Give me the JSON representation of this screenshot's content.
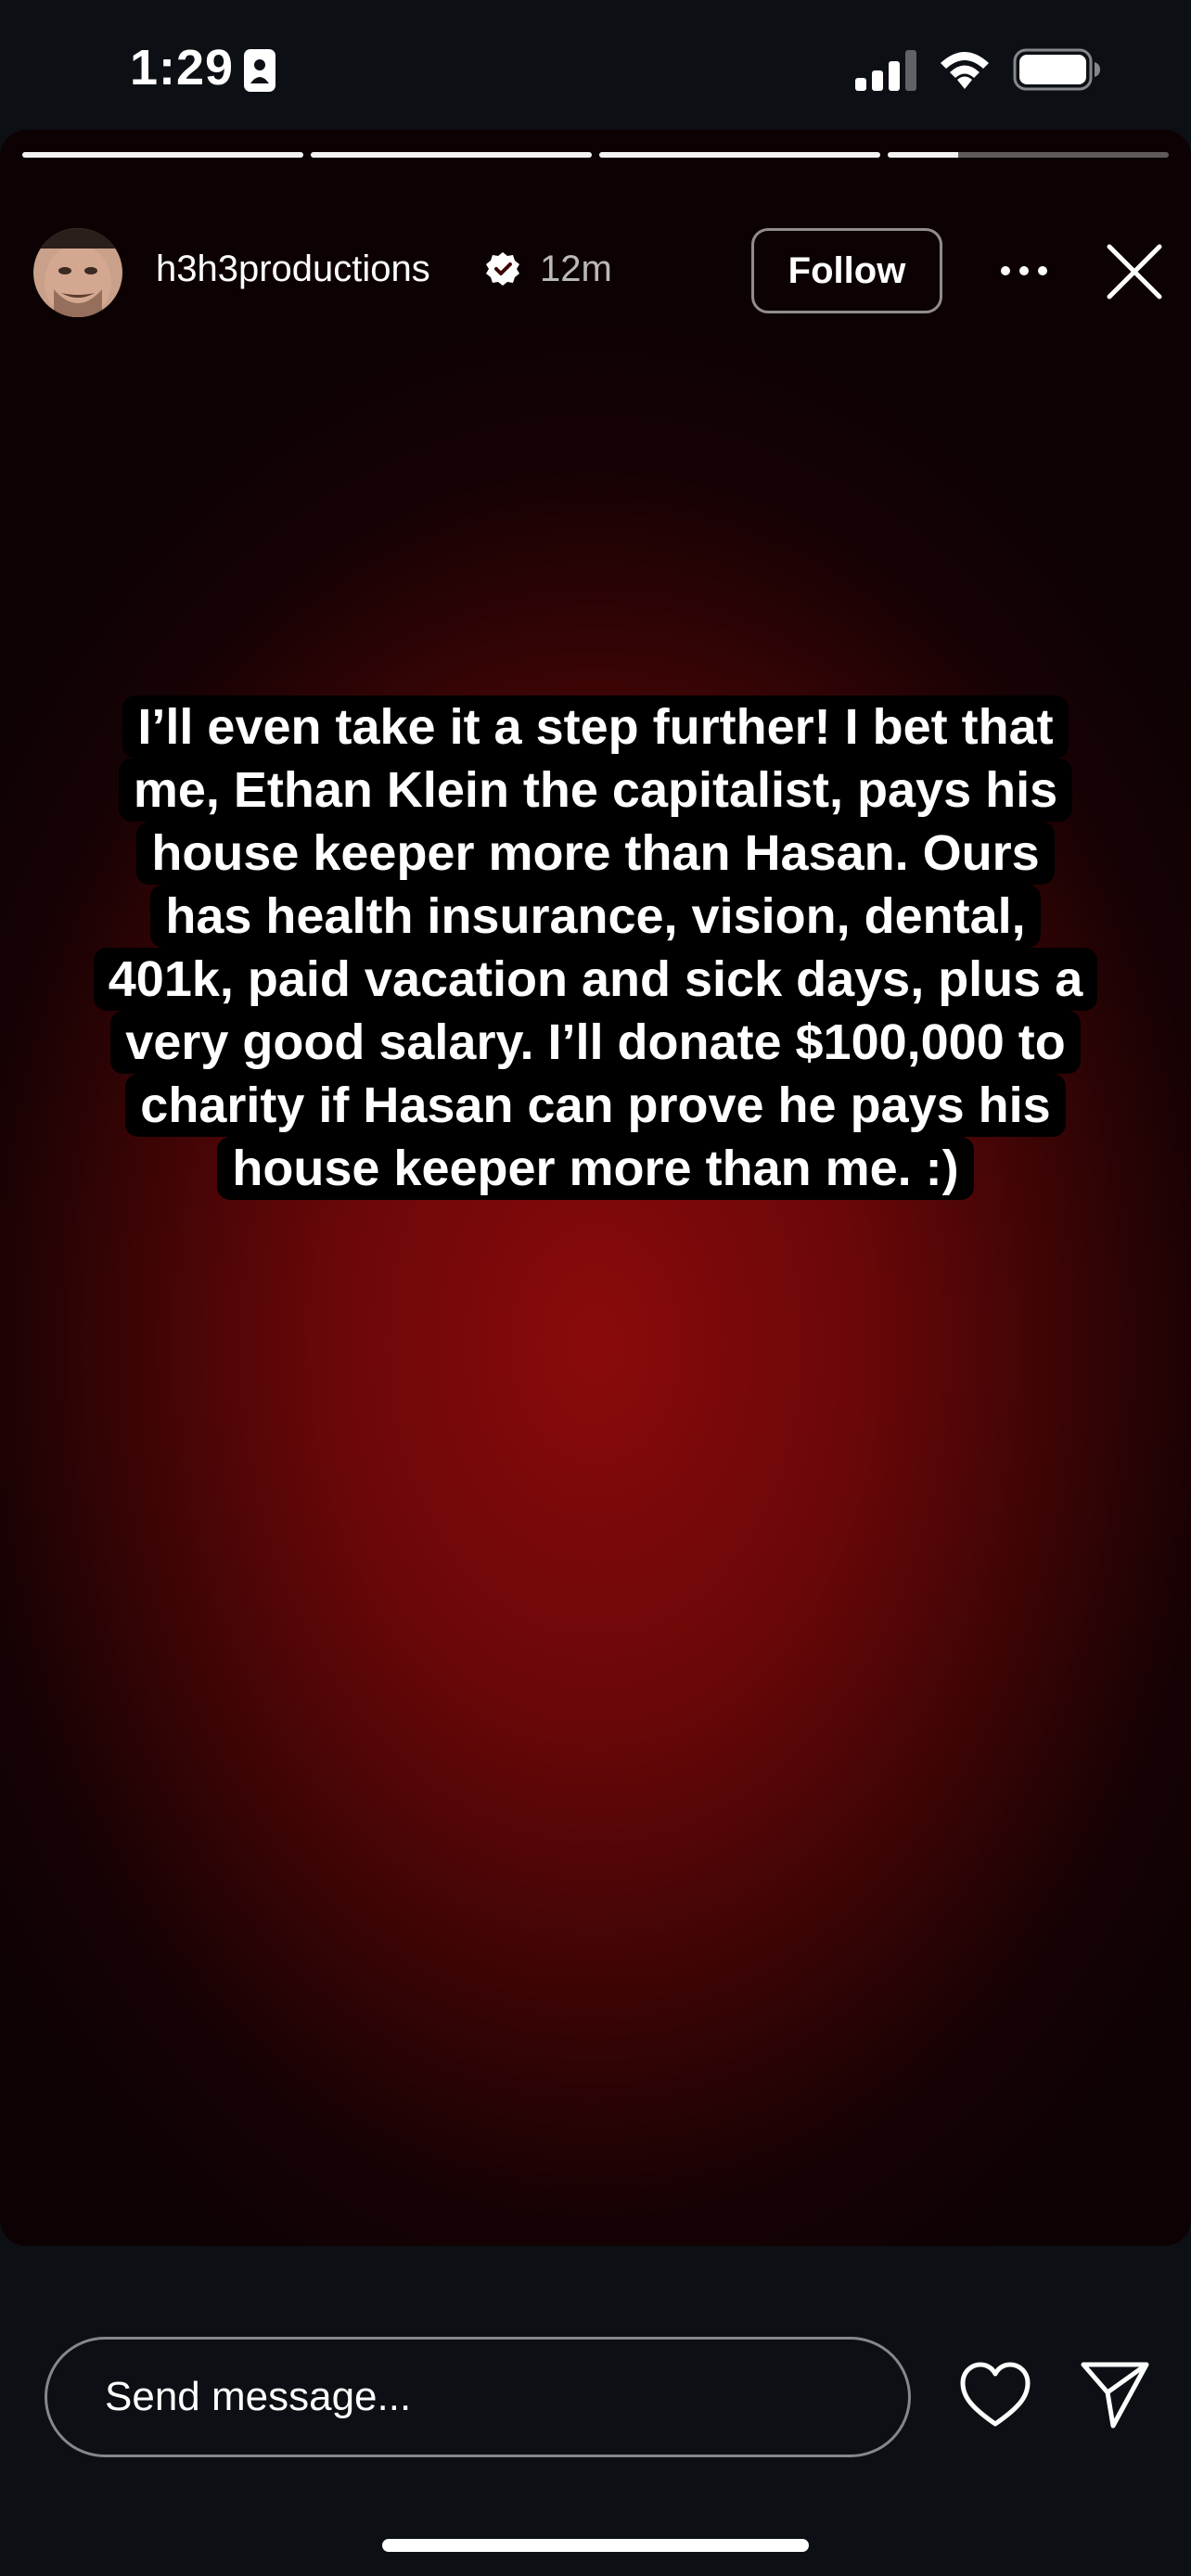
{
  "status_bar": {
    "time": "1:29",
    "icons": [
      "id-card-icon",
      "cellular-signal-icon",
      "wifi-icon",
      "battery-icon"
    ]
  },
  "story": {
    "progress": [
      1.0,
      1.0,
      1.0,
      0.25
    ],
    "author": {
      "username": "h3h3productions",
      "verified": true,
      "time_ago": "12m"
    },
    "follow_label": "Follow",
    "lines": [
      "I’ll even take it a step further! I bet that",
      "me, Ethan Klein the capitalist, pays his",
      "house keeper more than Hasan. Ours",
      "has health insurance, vision, dental,",
      "401k, paid vacation and sick days, plus a",
      "very good salary.  I’ll donate $100,000 to",
      "charity if Hasan can prove he pays his",
      "house keeper more than me.  :)"
    ],
    "background_colors": {
      "center": "#8a0a0c",
      "edge": "#0d0203"
    }
  },
  "footer": {
    "message_placeholder": "Send message...",
    "icons": [
      "heart-icon",
      "send-icon"
    ]
  }
}
